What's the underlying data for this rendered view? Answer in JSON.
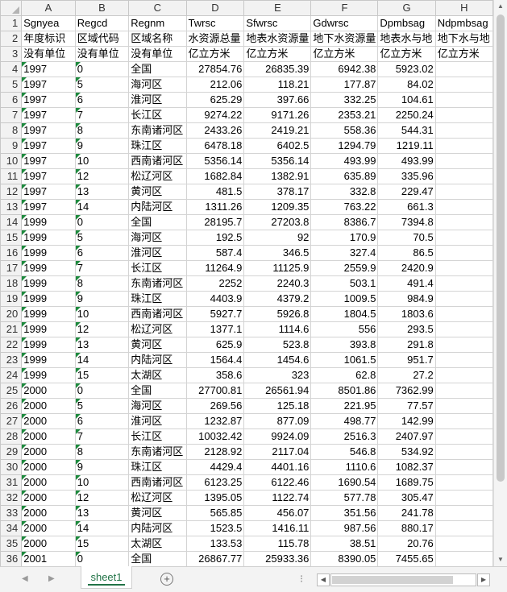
{
  "columns": [
    "A",
    "B",
    "C",
    "D",
    "E",
    "F",
    "G",
    "H"
  ],
  "rows": [
    {
      "n": "1",
      "cells": [
        "Sgnyea",
        "Regcd",
        "Regnm",
        "Twrsc",
        "Sfwrsc",
        "Gdwrsc",
        "Dpmbsag",
        "Ndpmbsag"
      ]
    },
    {
      "n": "2",
      "cells": [
        "年度标识",
        "区域代码",
        "区域名称",
        "水资源总量",
        "地表水资源量",
        "地下水资源量",
        "地表水与地",
        "地下水与地"
      ]
    },
    {
      "n": "3",
      "cells": [
        "没有单位",
        "没有单位",
        "没有单位",
        "亿立方米",
        "亿立方米",
        "亿立方米",
        "亿立方米",
        "亿立方米"
      ]
    },
    {
      "n": "4",
      "cells": [
        "1997",
        "0",
        "全国",
        "27854.76",
        "26835.39",
        "6942.38",
        "5923.02",
        ""
      ]
    },
    {
      "n": "5",
      "cells": [
        "1997",
        "5",
        "海河区",
        "212.06",
        "118.21",
        "177.87",
        "84.02",
        ""
      ]
    },
    {
      "n": "6",
      "cells": [
        "1997",
        "6",
        "淮河区",
        "625.29",
        "397.66",
        "332.25",
        "104.61",
        ""
      ]
    },
    {
      "n": "7",
      "cells": [
        "1997",
        "7",
        "长江区",
        "9274.22",
        "9171.26",
        "2353.21",
        "2250.24",
        ""
      ]
    },
    {
      "n": "8",
      "cells": [
        "1997",
        "8",
        "东南诸河区",
        "2433.26",
        "2419.21",
        "558.36",
        "544.31",
        ""
      ]
    },
    {
      "n": "9",
      "cells": [
        "1997",
        "9",
        "珠江区",
        "6478.18",
        "6402.5",
        "1294.79",
        "1219.11",
        ""
      ]
    },
    {
      "n": "10",
      "cells": [
        "1997",
        "10",
        "西南诸河区",
        "5356.14",
        "5356.14",
        "493.99",
        "493.99",
        ""
      ]
    },
    {
      "n": "11",
      "cells": [
        "1997",
        "12",
        "松辽河区",
        "1682.84",
        "1382.91",
        "635.89",
        "335.96",
        ""
      ]
    },
    {
      "n": "12",
      "cells": [
        "1997",
        "13",
        "黄河区",
        "481.5",
        "378.17",
        "332.8",
        "229.47",
        ""
      ]
    },
    {
      "n": "13",
      "cells": [
        "1997",
        "14",
        "内陆河区",
        "1311.26",
        "1209.35",
        "763.22",
        "661.3",
        ""
      ]
    },
    {
      "n": "14",
      "cells": [
        "1999",
        "0",
        "全国",
        "28195.7",
        "27203.8",
        "8386.7",
        "7394.8",
        ""
      ]
    },
    {
      "n": "15",
      "cells": [
        "1999",
        "5",
        "海河区",
        "192.5",
        "92",
        "170.9",
        "70.5",
        ""
      ]
    },
    {
      "n": "16",
      "cells": [
        "1999",
        "6",
        "淮河区",
        "587.4",
        "346.5",
        "327.4",
        "86.5",
        ""
      ]
    },
    {
      "n": "17",
      "cells": [
        "1999",
        "7",
        "长江区",
        "11264.9",
        "11125.9",
        "2559.9",
        "2420.9",
        ""
      ]
    },
    {
      "n": "18",
      "cells": [
        "1999",
        "8",
        "东南诸河区",
        "2252",
        "2240.3",
        "503.1",
        "491.4",
        ""
      ]
    },
    {
      "n": "19",
      "cells": [
        "1999",
        "9",
        "珠江区",
        "4403.9",
        "4379.2",
        "1009.5",
        "984.9",
        ""
      ]
    },
    {
      "n": "20",
      "cells": [
        "1999",
        "10",
        "西南诸河区",
        "5927.7",
        "5926.8",
        "1804.5",
        "1803.6",
        ""
      ]
    },
    {
      "n": "21",
      "cells": [
        "1999",
        "12",
        "松辽河区",
        "1377.1",
        "1114.6",
        "556",
        "293.5",
        ""
      ]
    },
    {
      "n": "22",
      "cells": [
        "1999",
        "13",
        "黄河区",
        "625.9",
        "523.8",
        "393.8",
        "291.8",
        ""
      ]
    },
    {
      "n": "23",
      "cells": [
        "1999",
        "14",
        "内陆河区",
        "1564.4",
        "1454.6",
        "1061.5",
        "951.7",
        ""
      ]
    },
    {
      "n": "24",
      "cells": [
        "1999",
        "15",
        "太湖区",
        "358.6",
        "323",
        "62.8",
        "27.2",
        ""
      ]
    },
    {
      "n": "25",
      "cells": [
        "2000",
        "0",
        "全国",
        "27700.81",
        "26561.94",
        "8501.86",
        "7362.99",
        ""
      ]
    },
    {
      "n": "26",
      "cells": [
        "2000",
        "5",
        "海河区",
        "269.56",
        "125.18",
        "221.95",
        "77.57",
        ""
      ]
    },
    {
      "n": "27",
      "cells": [
        "2000",
        "6",
        "淮河区",
        "1232.87",
        "877.09",
        "498.77",
        "142.99",
        ""
      ]
    },
    {
      "n": "28",
      "cells": [
        "2000",
        "7",
        "长江区",
        "10032.42",
        "9924.09",
        "2516.3",
        "2407.97",
        ""
      ]
    },
    {
      "n": "29",
      "cells": [
        "2000",
        "8",
        "东南诸河区",
        "2128.92",
        "2117.04",
        "546.8",
        "534.92",
        ""
      ]
    },
    {
      "n": "30",
      "cells": [
        "2000",
        "9",
        "珠江区",
        "4429.4",
        "4401.16",
        "1110.6",
        "1082.37",
        ""
      ]
    },
    {
      "n": "31",
      "cells": [
        "2000",
        "10",
        "西南诸河区",
        "6123.25",
        "6122.46",
        "1690.54",
        "1689.75",
        ""
      ]
    },
    {
      "n": "32",
      "cells": [
        "2000",
        "12",
        "松辽河区",
        "1395.05",
        "1122.74",
        "577.78",
        "305.47",
        ""
      ]
    },
    {
      "n": "33",
      "cells": [
        "2000",
        "13",
        "黄河区",
        "565.85",
        "456.07",
        "351.56",
        "241.78",
        ""
      ]
    },
    {
      "n": "34",
      "cells": [
        "2000",
        "14",
        "内陆河区",
        "1523.5",
        "1416.11",
        "987.56",
        "880.17",
        ""
      ]
    },
    {
      "n": "35",
      "cells": [
        "2000",
        "15",
        "太湖区",
        "133.53",
        "115.78",
        "38.51",
        "20.76",
        ""
      ]
    },
    {
      "n": "36",
      "cells": [
        "2001",
        "0",
        "全国",
        "26867.77",
        "25933.36",
        "8390.05",
        "7455.65",
        ""
      ]
    }
  ],
  "sheet_tab": "sheet1",
  "colors": {
    "accent": "#217346",
    "marker": "#1e8a3e"
  },
  "icons": {
    "add_sheet": "plus-circle-icon",
    "first": "nav-first-icon",
    "prev": "nav-prev-icon"
  }
}
